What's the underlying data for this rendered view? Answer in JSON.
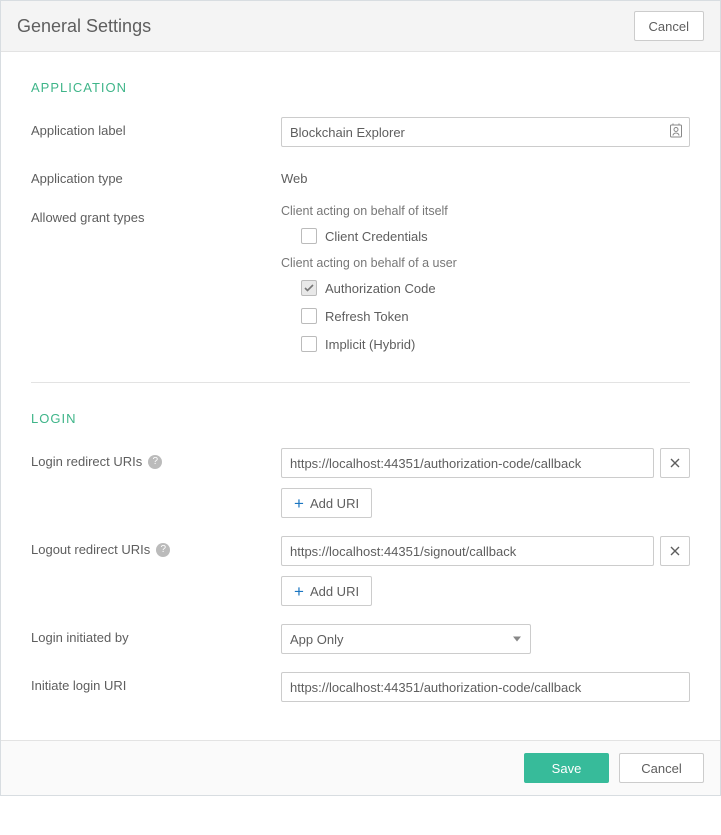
{
  "header": {
    "title": "General Settings",
    "cancel": "Cancel"
  },
  "sections": {
    "application": {
      "heading": "APPLICATION",
      "labels": {
        "app_label": "Application label",
        "app_type": "Application type",
        "grant_types": "Allowed grant types"
      },
      "values": {
        "app_label": "Blockchain Explorer",
        "app_type": "Web"
      },
      "grant": {
        "self_heading": "Client acting on behalf of itself",
        "user_heading": "Client acting on behalf of a user",
        "client_credentials": {
          "label": "Client Credentials",
          "checked": false
        },
        "authorization_code": {
          "label": "Authorization Code",
          "checked": true
        },
        "refresh_token": {
          "label": "Refresh Token",
          "checked": false
        },
        "implicit": {
          "label": "Implicit (Hybrid)",
          "checked": false
        }
      }
    },
    "login": {
      "heading": "LOGIN",
      "labels": {
        "login_redirect": "Login redirect URIs",
        "logout_redirect": "Logout redirect URIs",
        "initiated_by": "Login initiated by",
        "initiate_uri": "Initiate login URI"
      },
      "values": {
        "login_redirect_0": "https://localhost:44351/authorization-code/callback",
        "logout_redirect_0": "https://localhost:44351/signout/callback",
        "initiated_by": "App Only",
        "initiate_uri": "https://localhost:44351/authorization-code/callback"
      },
      "buttons": {
        "add_uri": "Add URI"
      }
    }
  },
  "footer": {
    "save": "Save",
    "cancel": "Cancel"
  },
  "help_glyph": "?"
}
